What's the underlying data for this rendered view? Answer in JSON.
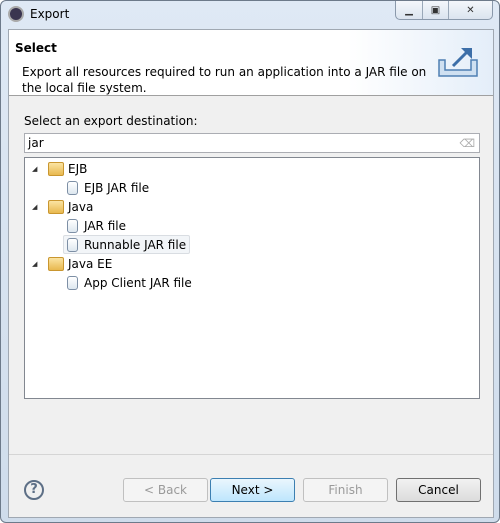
{
  "window": {
    "title": "Export",
    "controls": {
      "minimize": "minimize-icon",
      "maximize": "maximize-icon",
      "close": "close-icon"
    }
  },
  "header": {
    "title": "Select",
    "description": "Export all resources required to run an application into a JAR file on the local file system."
  },
  "destination_label": "Select an export destination:",
  "filter": {
    "value": "jar"
  },
  "tree": [
    {
      "label": "EJB",
      "type": "folder",
      "expanded": true,
      "children": [
        {
          "label": "EJB JAR file"
        }
      ]
    },
    {
      "label": "Java",
      "type": "folder",
      "expanded": true,
      "children": [
        {
          "label": "JAR file"
        },
        {
          "label": "Runnable JAR file",
          "selected": true
        }
      ]
    },
    {
      "label": "Java EE",
      "type": "folder",
      "expanded": true,
      "children": [
        {
          "label": "App Client JAR file"
        }
      ]
    }
  ],
  "buttons": {
    "help": "?",
    "back": "< Back",
    "next": "Next >",
    "finish": "Finish",
    "cancel": "Cancel"
  }
}
